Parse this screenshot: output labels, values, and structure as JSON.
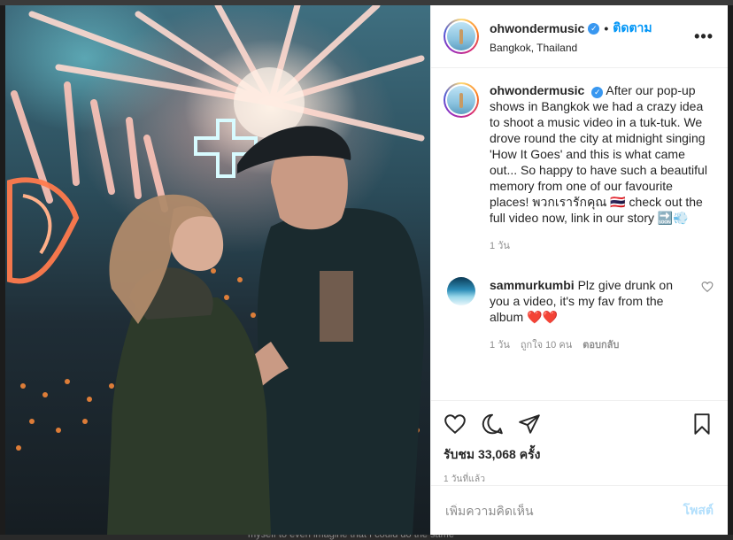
{
  "backdrop": {
    "bottom_text": "myself to even imagine that I could do the same"
  },
  "post": {
    "username": "ohwondermusic",
    "follow_label": "ติดตาม",
    "location": "Bangkok, Thailand",
    "more_label": "•••",
    "caption": "After our pop-up shows in Bangkok we had a crazy idea to shoot a music video in a tuk-tuk. We drove round the city at midnight singing 'How It Goes' and this is what came out... So happy to have such a beautiful memory from one of our favourite places! พวกเรารักคุณ 🇹🇭  check out the full video now, link in our story 🔜💨",
    "caption_time": "1 วัน",
    "views": "รับชม 33,068 ครั้ง",
    "posted_ago": "1 วันที่แล้ว"
  },
  "comments": [
    {
      "username": "sammurkumbi",
      "text": "Plz give drunk on you a video, it's my fav from the album ❤️❤️",
      "time": "1 วัน",
      "likes": "ถูกใจ 10 คน",
      "reply_label": "ตอบกลับ"
    }
  ],
  "composer": {
    "placeholder": "เพิ่มความคิดเห็น",
    "post_label": "โพสต์"
  },
  "colors": {
    "accent": "#0095f6",
    "post_disabled": "#b2dffc",
    "verified": "#3897f0"
  },
  "icons": [
    "verified-badge-icon",
    "more-options-icon",
    "heart-icon",
    "comment-icon",
    "share-icon",
    "bookmark-icon",
    "comment-heart-icon"
  ]
}
